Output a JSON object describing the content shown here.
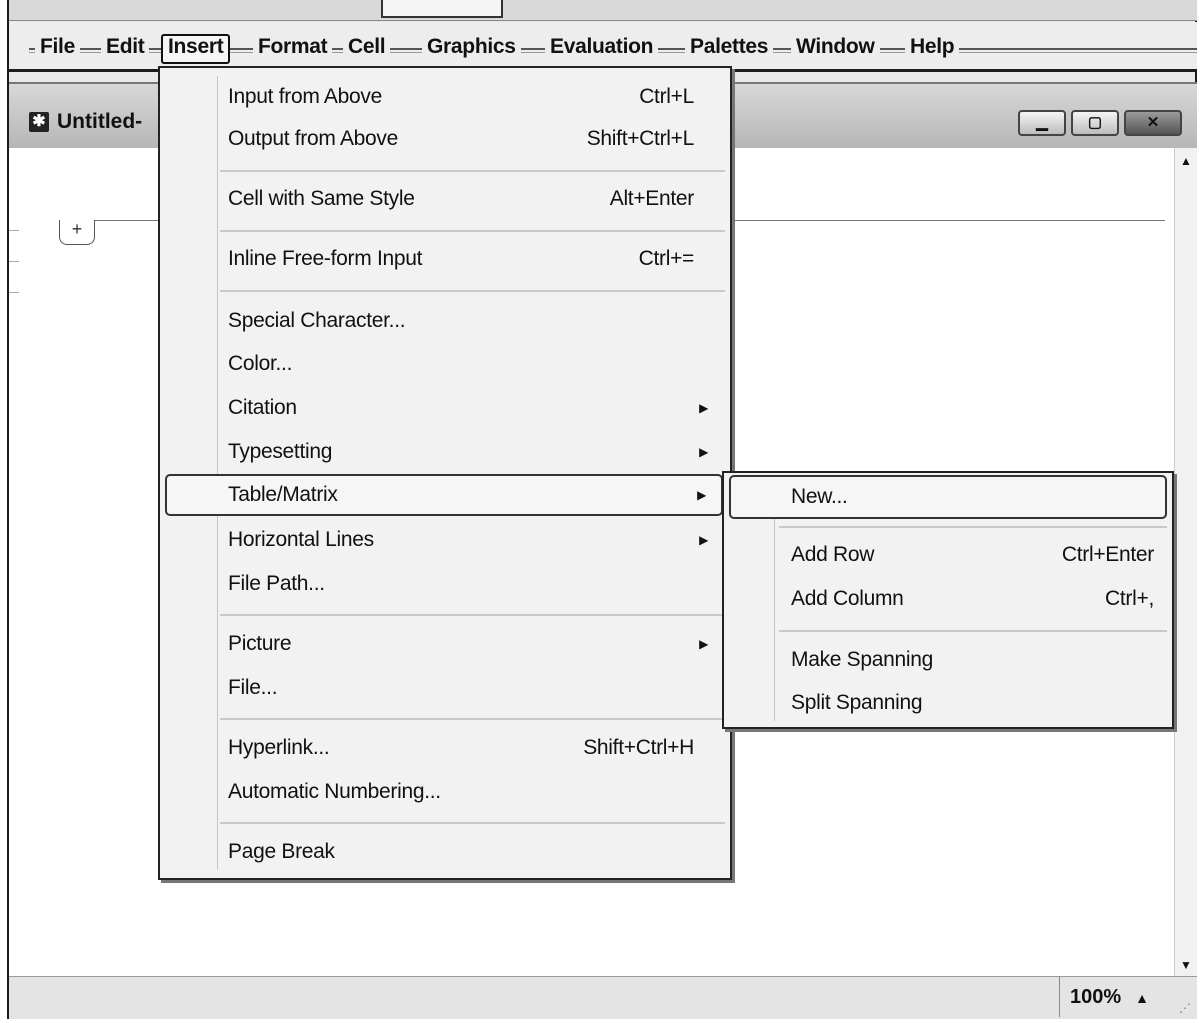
{
  "menubar": {
    "items": [
      "File",
      "Edit",
      "Insert",
      "Format",
      "Cell",
      "Graphics",
      "Evaluation",
      "Palettes",
      "Window",
      "Help"
    ],
    "active": "Insert"
  },
  "document": {
    "title": "Untitled-",
    "zoom": "100%",
    "cell_insert_label": "+"
  },
  "insert_menu": {
    "items": [
      {
        "label": "Input from Above",
        "shortcut": "Ctrl+L"
      },
      {
        "label": "Output from Above",
        "shortcut": "Shift+Ctrl+L"
      },
      {
        "label": "Cell with Same Style",
        "shortcut": "Alt+Enter"
      },
      {
        "label": "Inline Free-form Input",
        "shortcut": "Ctrl+="
      },
      {
        "label": "Special Character...",
        "shortcut": ""
      },
      {
        "label": "Color...",
        "shortcut": ""
      },
      {
        "label": "Citation",
        "submenu": true
      },
      {
        "label": "Typesetting",
        "submenu": true
      },
      {
        "label": "Table/Matrix",
        "submenu": true,
        "highlighted": true
      },
      {
        "label": "Horizontal Lines",
        "submenu": true
      },
      {
        "label": "File Path...",
        "shortcut": ""
      },
      {
        "label": "Picture",
        "submenu": true
      },
      {
        "label": "File...",
        "shortcut": ""
      },
      {
        "label": "Hyperlink...",
        "shortcut": "Shift+Ctrl+H"
      },
      {
        "label": "Automatic Numbering...",
        "shortcut": ""
      },
      {
        "label": "Page Break",
        "shortcut": ""
      }
    ]
  },
  "table_matrix_submenu": {
    "items": [
      {
        "label": "New...",
        "highlighted": true
      },
      {
        "label": "Add Row",
        "shortcut": "Ctrl+Enter"
      },
      {
        "label": "Add Column",
        "shortcut": "Ctrl+,"
      },
      {
        "label": "Make Spanning",
        "shortcut": ""
      },
      {
        "label": "Split Spanning",
        "shortcut": ""
      }
    ]
  },
  "icons": {
    "doc_icon": "notebook-cog-icon",
    "submenu_arrow": "triangle-right-icon"
  }
}
